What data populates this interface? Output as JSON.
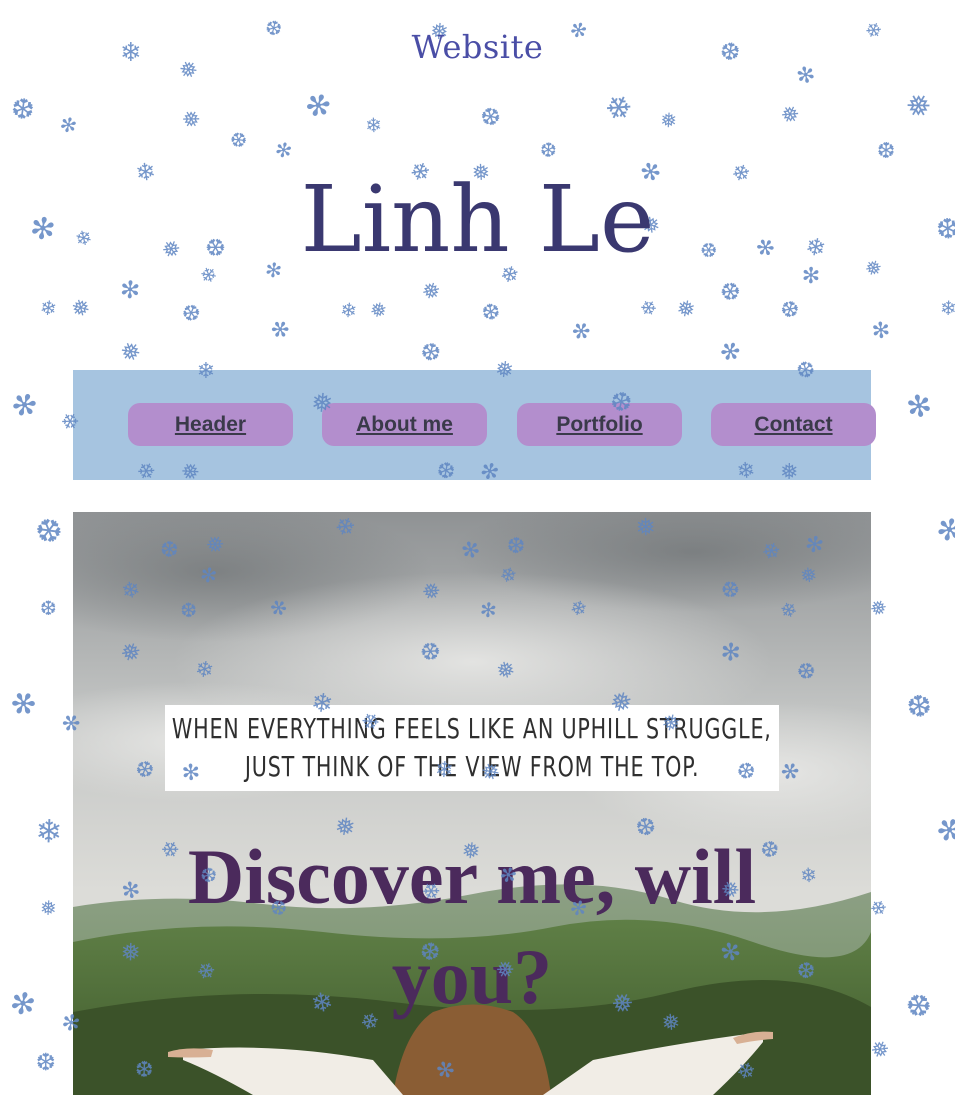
{
  "header": {
    "site_label": "Website",
    "name": "Linh Le"
  },
  "nav": {
    "items": [
      {
        "label": "Header"
      },
      {
        "label": "About me"
      },
      {
        "label": "Portfolio"
      },
      {
        "label": "Contact"
      }
    ]
  },
  "hero": {
    "quote_line_1": "WHEN EVERYTHING FEELS LIKE AN UPHILL STRUGGLE,",
    "quote_line_2": "JUST THINK OF THE VIEW FROM THE TOP.",
    "heading_line_1": "Discover me, will",
    "heading_line_2": "you?"
  },
  "colors": {
    "snowflake": "#5f86c2",
    "nav_bg": "#a6c4e0",
    "nav_button": "#b38ecd",
    "title": "#3a3870",
    "hero_heading": "#4b2a5c"
  }
}
